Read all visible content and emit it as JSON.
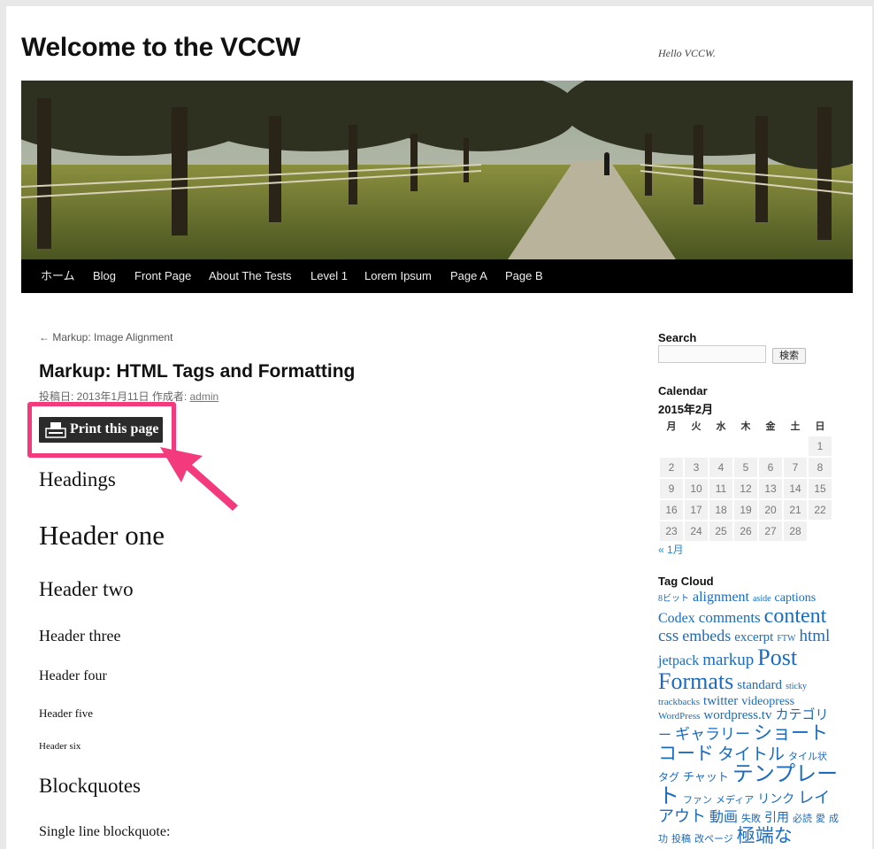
{
  "site": {
    "title": "Welcome to the VCCW",
    "description": "Hello VCCW."
  },
  "nav": [
    "ホーム",
    "Blog",
    "Front Page",
    "About The Tests",
    "Level 1",
    "Lorem Ipsum",
    "Page A",
    "Page B"
  ],
  "post": {
    "prev_link": "← Markup: Image Alignment",
    "title": "Markup: HTML Tags and Formatting",
    "meta_prefix": "投稿日: 2013年1月11日  作成者: ",
    "author": "admin",
    "print_label": "Print this page"
  },
  "content": {
    "headings_title": "Headings",
    "h1": "Header one",
    "h2": "Header two",
    "h3": "Header three",
    "h4": "Header four",
    "h5": "Header five",
    "h6": "Header six",
    "blockquotes_title": "Blockquotes",
    "single_line": "Single line blockquote:"
  },
  "sidebar": {
    "search_title": "Search",
    "search_value": "",
    "search_button": "検索",
    "calendar_title": "Calendar",
    "calendar_caption": "2015年2月",
    "weekdays": [
      "月",
      "火",
      "水",
      "木",
      "金",
      "土",
      "日"
    ],
    "weeks": [
      [
        "",
        "",
        "",
        "",
        "",
        "",
        "1"
      ],
      [
        "2",
        "3",
        "4",
        "5",
        "6",
        "7",
        "8"
      ],
      [
        "9",
        "10",
        "11",
        "12",
        "13",
        "14",
        "15"
      ],
      [
        "16",
        "17",
        "18",
        "19",
        "20",
        "21",
        "22"
      ],
      [
        "23",
        "24",
        "25",
        "26",
        "27",
        "28",
        ""
      ]
    ],
    "calendar_prev": "« 1月",
    "tag_cloud_title": "Tag Cloud",
    "tags": [
      "8ビット",
      "alignment",
      "aside",
      "captions",
      "Codex",
      "comments",
      "content",
      "css",
      "embeds",
      "excerpt",
      "FTW",
      "html",
      "jetpack",
      "markup",
      "Post Formats",
      "standard",
      "sticky",
      "trackbacks",
      "twitter",
      "videopress",
      "WordPress",
      "wordpress.tv",
      "カテゴリー",
      "ギャラリー",
      "ショートコード",
      "タイトル",
      "タイル状",
      "タグ",
      "チャット",
      "テンプレート",
      "ファン",
      "メディア",
      "リンク",
      "レイアウト",
      "動画",
      "失敗",
      "引用",
      "必読",
      "愛",
      "成功",
      "投稿",
      "改ページ",
      "極端な"
    ]
  },
  "colors": {
    "highlight": "#f23a7d",
    "link": "#1b6bc0",
    "nav_bg": "#000000"
  }
}
